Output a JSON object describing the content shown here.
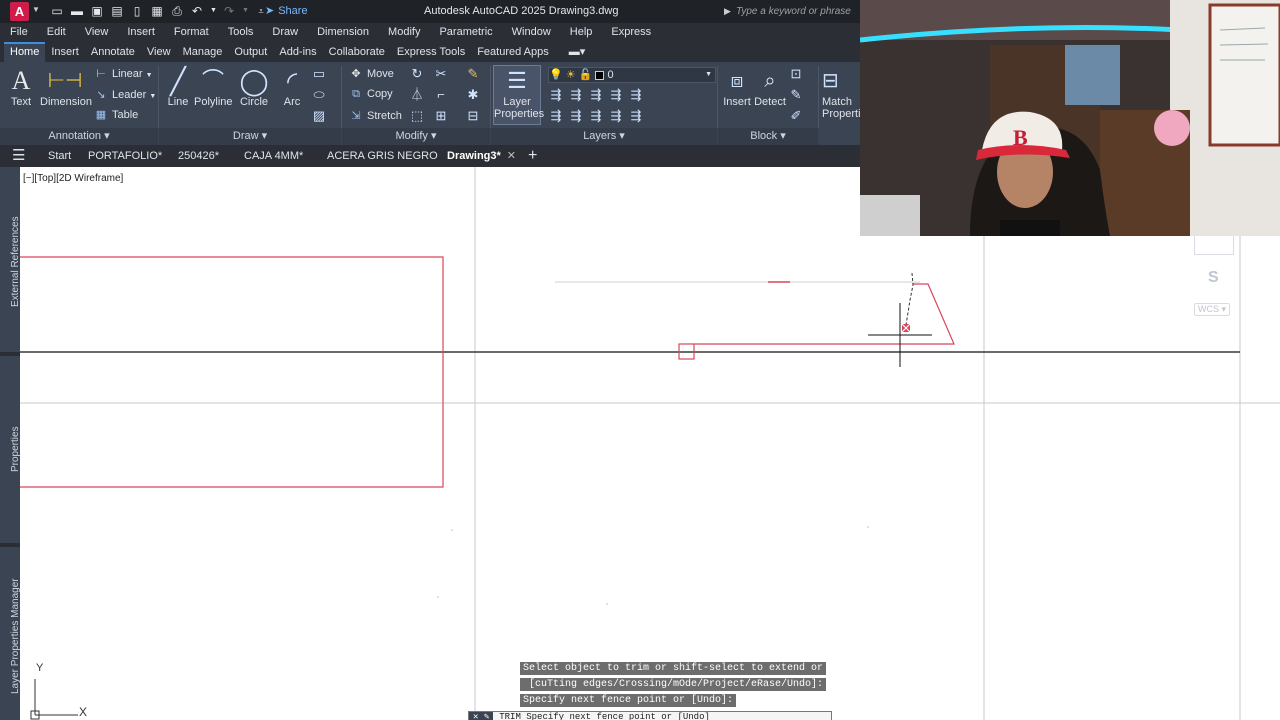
{
  "app": {
    "logo_letter": "A",
    "title": "Autodesk AutoCAD 2025    Drawing3.dwg",
    "share_label": "Share",
    "search_placeholder": "Type a keyword or phrase"
  },
  "menu": [
    "File",
    "Edit",
    "View",
    "Insert",
    "Format",
    "Tools",
    "Draw",
    "Dimension",
    "Modify",
    "Parametric",
    "Window",
    "Help",
    "Express"
  ],
  "ribbon_tabs": [
    "Home",
    "Insert",
    "Annotate",
    "View",
    "Manage",
    "Output",
    "Add-ins",
    "Collaborate",
    "Express Tools",
    "Featured Apps"
  ],
  "ribbon": {
    "annotation": {
      "title": "Annotation",
      "text": "Text",
      "dimension": "Dimension",
      "linear": "Linear",
      "leader": "Leader",
      "table": "Table"
    },
    "draw": {
      "title": "Draw",
      "line": "Line",
      "polyline": "Polyline",
      "circle": "Circle",
      "arc": "Arc"
    },
    "modify": {
      "title": "Modify",
      "move": "Move",
      "copy": "Copy",
      "stretch": "Stretch"
    },
    "layers": {
      "title": "Layers",
      "layer_properties": "Layer Properties",
      "current_layer": "0"
    },
    "block": {
      "title": "Block",
      "insert": "Insert",
      "detect": "Detect"
    },
    "match": "Match Properties"
  },
  "file_tabs": [
    "Start",
    "PORTAFOLIO*",
    "250426*",
    "CAJA 4MM*",
    "ACERA GRIS NEGRO",
    "Drawing3*"
  ],
  "viewport": {
    "label": "[−][Top][2D Wireframe]",
    "palettes": [
      "External References",
      "Properties",
      "Layer Properties Manager"
    ],
    "viewcube_letter": "S",
    "wcs": "WCS",
    "ucs_y": "Y",
    "ucs_x": "X"
  },
  "command": {
    "line1": "Select object to trim or shift-select to extend or",
    "line2": " [cuTting edges/Crossing/mOde/Project/eRase/Undo]:",
    "line3": "Specify next fence point or [Undo]:",
    "prompt": "TRIM Specify next fence point or [Undo]"
  },
  "colors": {
    "accent": "#3b8ee0",
    "drawing_line": "#d9455a",
    "ribbon_bg": "#3b4453"
  }
}
